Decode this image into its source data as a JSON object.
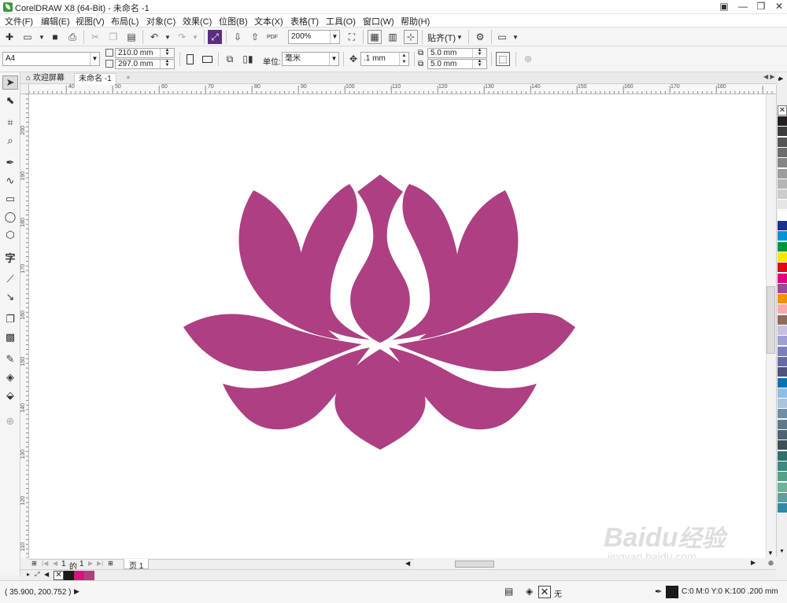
{
  "app": {
    "title": "CorelDRAW X8 (64-Bit) - 未命名 -1"
  },
  "window_controls": {
    "minimize": "—",
    "maximize": "❐",
    "close": "✕"
  },
  "menu": [
    "文件(F)",
    "编辑(E)",
    "视图(V)",
    "布局(L)",
    "对象(C)",
    "效果(C)",
    "位图(B)",
    "文本(X)",
    "表格(T)",
    "工具(O)",
    "窗口(W)",
    "帮助(H)"
  ],
  "standard_toolbar": {
    "zoom_value": "200%",
    "pdf_label": "PDF",
    "snap_label": "贴齐(T)"
  },
  "property_bar": {
    "page_size": "A4",
    "width": "210.0 mm",
    "height": "297.0 mm",
    "unit_label": "单位:",
    "unit_value": "毫米",
    "nudge": ".1 mm",
    "dup_x": "5.0 mm",
    "dup_y": "5.0 mm"
  },
  "tabs": {
    "welcome": "欢迎屏幕",
    "document": "未命名 -1",
    "add": "+"
  },
  "ruler": {
    "h_ticks": [
      "40",
      "50",
      "60",
      "70",
      "80",
      "90",
      "100",
      "110",
      "120",
      "130",
      "140",
      "150",
      "160",
      "170",
      "180"
    ],
    "v_ticks": [
      "200",
      "190",
      "180",
      "170",
      "160",
      "150",
      "140",
      "130",
      "120",
      "110"
    ]
  },
  "page_nav": {
    "current": "1",
    "of_label": "的",
    "total": "1",
    "page_tab": "页 1"
  },
  "document_palette": [
    "#ffffff",
    "#1a1a1a",
    "#e0107a",
    "#b0407a"
  ],
  "color_palette": [
    "#231f20",
    "#3d3d3d",
    "#555555",
    "#6d6d6d",
    "#858585",
    "#9d9d9d",
    "#b5b5b5",
    "#cdcdcd",
    "#e5e5e5",
    "#ffffff",
    "#1d2f8f",
    "#0093dd",
    "#00963f",
    "#ffe500",
    "#e30613",
    "#e5007e",
    "#9b4a97",
    "#f39200",
    "#f7aaac",
    "#8c6c5c",
    "#c9bfe3",
    "#9fa0d1",
    "#7b7fbf",
    "#686aa6",
    "#50537f",
    "#0073b7",
    "#8fbde6",
    "#a9c4dc",
    "#6d8ea8",
    "#5e7a8a",
    "#4c6470",
    "#3d5058",
    "#2f6f6a",
    "#3c8a80",
    "#54a08a",
    "#6db39a",
    "#5f9ea0",
    "#2f8aa5"
  ],
  "status": {
    "coords": "( 35.900, 200.752 )",
    "fill_label": "无",
    "outline": "C:0 M:0 Y:0 K:100  .200 mm"
  },
  "artwork": {
    "lotus_color": "#ad3f82"
  },
  "watermark": {
    "brand": "Baidu",
    "brand_cn": "经验",
    "url": "jingyan.baidu.com"
  }
}
